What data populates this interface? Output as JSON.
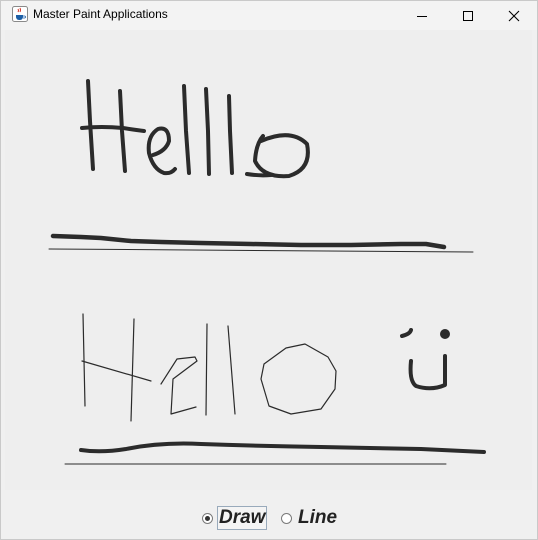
{
  "window": {
    "title": "Master Paint Applications",
    "icon": "java-cup-icon"
  },
  "controls": {
    "minimize": "minimize-icon",
    "maximize": "maximize-icon",
    "close": "close-icon"
  },
  "modes": [
    {
      "label": "Draw",
      "selected": true
    },
    {
      "label": "Line",
      "selected": false
    }
  ],
  "colors": {
    "stroke": "#2b2b2b",
    "canvas": "#eeeeee"
  }
}
